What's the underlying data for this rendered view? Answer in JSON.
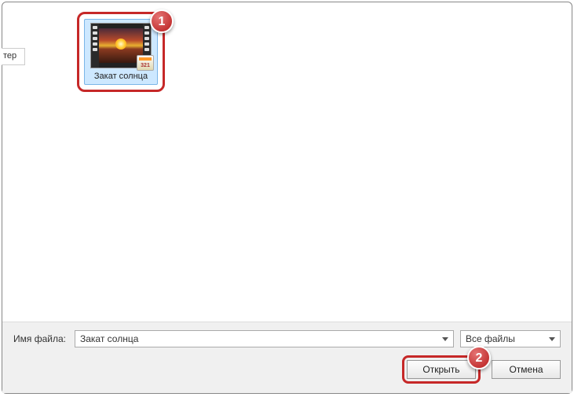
{
  "sidebar": {
    "fragment_text": "тер"
  },
  "file": {
    "name": "Закат солнца",
    "app_badge": "321"
  },
  "markers": {
    "one": "1",
    "two": "2"
  },
  "footer": {
    "filename_label": "Имя файла:",
    "filename_value": "Закат солнца",
    "filter_value": "Все файлы",
    "open_label": "Открыть",
    "cancel_label": "Отмена"
  }
}
